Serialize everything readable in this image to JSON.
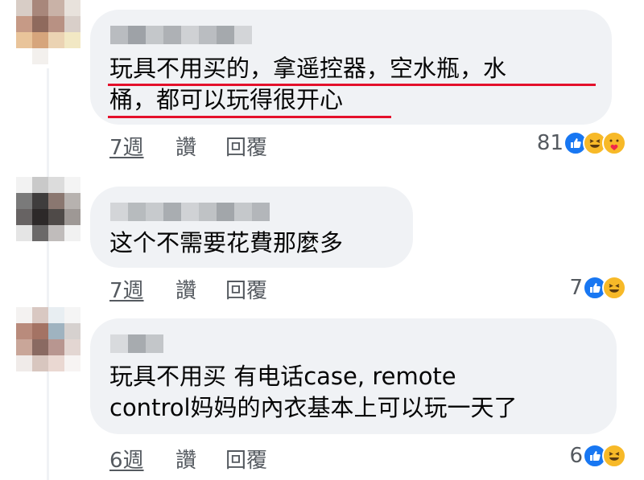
{
  "colors": {
    "bubble_bg": "#f0f2f5",
    "underline": "#e4102b",
    "meta_text": "#555a60",
    "like_blue": "#1877f2",
    "emoji_yellow": "#f7b928"
  },
  "comments": [
    {
      "lines": [
        "玩具不用买的，拿遥控器，空水瓶，水",
        "桶，都可以玩得很开心"
      ],
      "time": "7週",
      "like_label": "讚",
      "reply_label": "回覆",
      "reaction_count": "81",
      "reactions": [
        "like-icon",
        "haha-icon",
        "care-icon"
      ],
      "highlighted": true
    },
    {
      "lines": [
        "这个不需要花費那麼多"
      ],
      "time": "7週",
      "like_label": "讚",
      "reply_label": "回覆",
      "reaction_count": "7",
      "reactions": [
        "like-icon",
        "haha-icon"
      ]
    },
    {
      "lines": [
        "玩具不用买 有电话case, remote",
        "control妈妈的內衣基本上可以玩一天了"
      ],
      "time": "6週",
      "like_label": "讚",
      "reply_label": "回覆",
      "reaction_count": "6",
      "reactions": [
        "like-icon",
        "haha-icon"
      ]
    }
  ]
}
